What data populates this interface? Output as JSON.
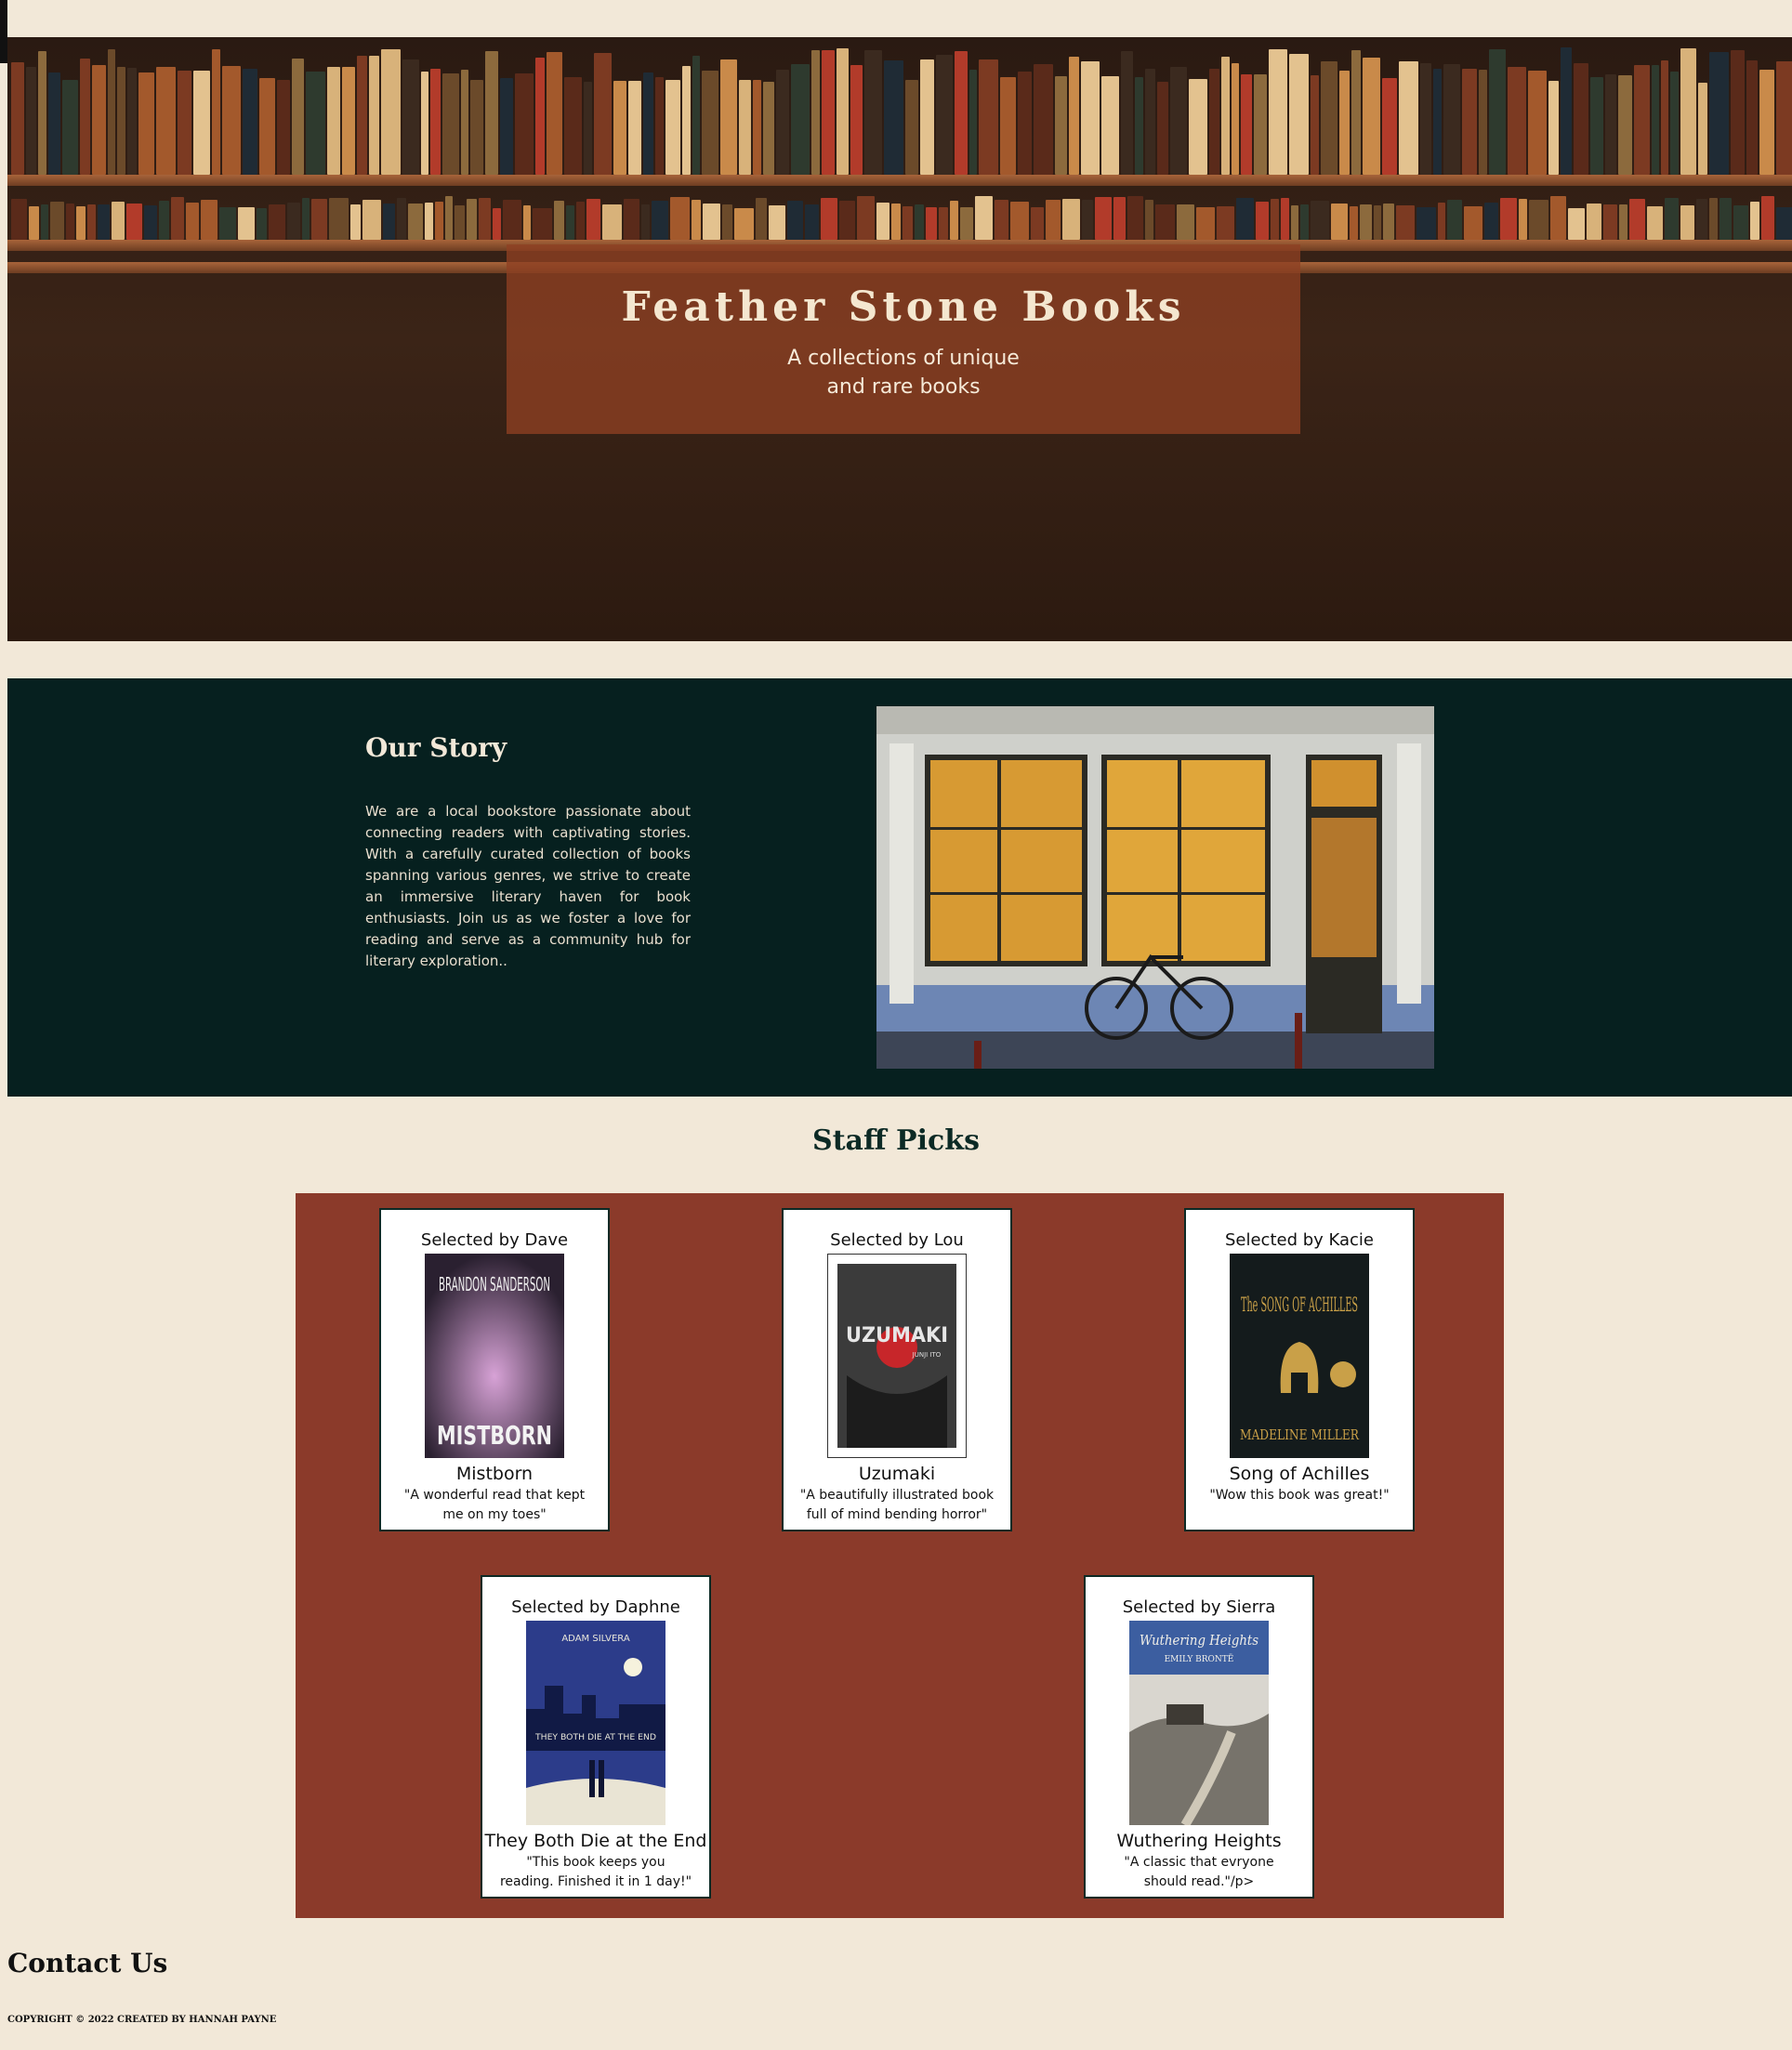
{
  "hero": {
    "title": "Feather Stone Books",
    "subtitle": "A collections of unique and rare books"
  },
  "story": {
    "heading": "Our Story",
    "body": "We are a local bookstore passionate about connecting readers with captivating stories. With a carefully curated collection of books spanning various genres, we strive to create an immersive literary haven for book enthusiasts. Join us as we foster a love for reading and serve as a community hub for literary exploration.."
  },
  "staff_picks": {
    "heading": "Staff Picks",
    "picks": [
      {
        "selector": "Selected by Dave",
        "title": "Mistborn",
        "quote": "\"A wonderful read that kept me on my toes\"",
        "cover_title": "MISTBORN",
        "cover_author": "BRANDON SANDERSON"
      },
      {
        "selector": "Selected by Lou",
        "title": "Uzumaki",
        "quote": "\"A beautifully illustrated book full of mind bending horror\"",
        "cover_title": "UZUMAKI",
        "cover_author": "JUNJI ITO"
      },
      {
        "selector": "Selected by Kacie",
        "title": "Song of Achilles",
        "quote": "\"Wow this book was great!\"",
        "cover_title": "The SONG OF ACHILLES",
        "cover_author": "MADELINE MILLER"
      },
      {
        "selector": "Selected by Daphne",
        "title": "They Both Die at the End",
        "quote": "\"This book keeps you reading. Finished it in 1 day!\"",
        "cover_title": "THEY BOTH DIE AT THE END",
        "cover_author": "ADAM SILVERA"
      },
      {
        "selector": "Selected by Sierra",
        "title": "Wuthering Heights",
        "quote": "\"A classic that evryone should read.\"/p>",
        "cover_title": "Wuthering Heights",
        "cover_author": "EMILY BRONTË"
      }
    ]
  },
  "footer": {
    "contact_heading": "Contact Us",
    "copyright": "COPYRIGHT © 2022 CREATED BY HANNAH PAYNE"
  }
}
